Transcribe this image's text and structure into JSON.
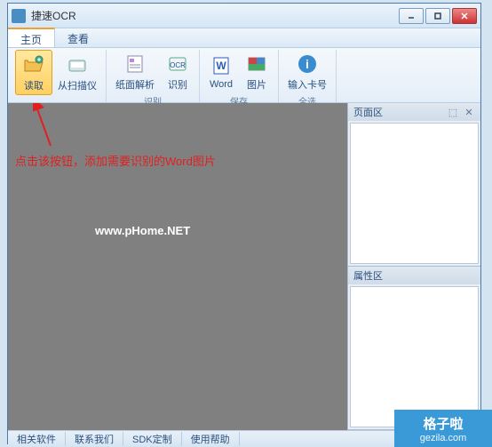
{
  "window": {
    "title": "捷速OCR"
  },
  "menu": {
    "main": "主页",
    "view": "查看"
  },
  "toolbar": {
    "read": "读取",
    "scanner": "从扫描仪",
    "parse": "纸面解析",
    "recognize": "识别",
    "word": "Word",
    "image": "图片",
    "card": "输入卡号",
    "group_recognize": "识别",
    "group_save": "保存",
    "group_all": "全选"
  },
  "canvas": {
    "annotation": "点击该按钮，添加需要识别的Word图片",
    "watermark": "www.pHome.NET"
  },
  "panels": {
    "pages": "页面区",
    "props": "属性区"
  },
  "status": {
    "related": "相关软件",
    "contact": "联系我们",
    "sdk": "SDK定制",
    "help": "使用帮助"
  },
  "brand": {
    "name": "格子啦",
    "url": "gezila.com"
  }
}
